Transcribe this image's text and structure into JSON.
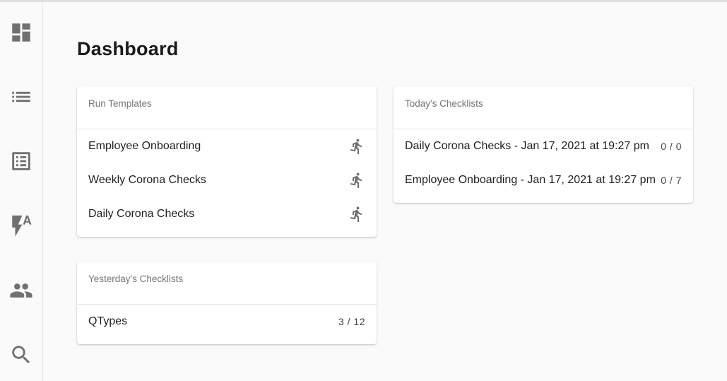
{
  "nav": {
    "items": [
      {
        "icon": "dashboard-icon"
      },
      {
        "icon": "list-icon"
      },
      {
        "icon": "list-alt-icon"
      },
      {
        "icon": "flash-auto-icon"
      },
      {
        "icon": "people-icon"
      },
      {
        "icon": "search-icon"
      }
    ]
  },
  "page": {
    "title": "Dashboard"
  },
  "run_templates": {
    "header": "Run Templates",
    "items": [
      {
        "label": "Employee Onboarding",
        "icon": "run-icon"
      },
      {
        "label": "Weekly Corona Checks",
        "icon": "run-icon"
      },
      {
        "label": "Daily Corona Checks",
        "icon": "run-icon"
      }
    ]
  },
  "yesterday": {
    "header": "Yesterday's Checklists",
    "items": [
      {
        "label": "QTypes",
        "progress": "3 / 12"
      }
    ]
  },
  "today": {
    "header": "Today's Checklists",
    "items": [
      {
        "label": "Daily Corona Checks - Jan 17, 2021 at 19:27 pm",
        "progress": "0 / 0"
      },
      {
        "label": "Employee Onboarding - Jan 17, 2021 at 19:27 pm",
        "progress": "0 / 7"
      }
    ]
  },
  "colors": {
    "background": "#fafafa",
    "icon": "#707070",
    "card": "#ffffff"
  }
}
